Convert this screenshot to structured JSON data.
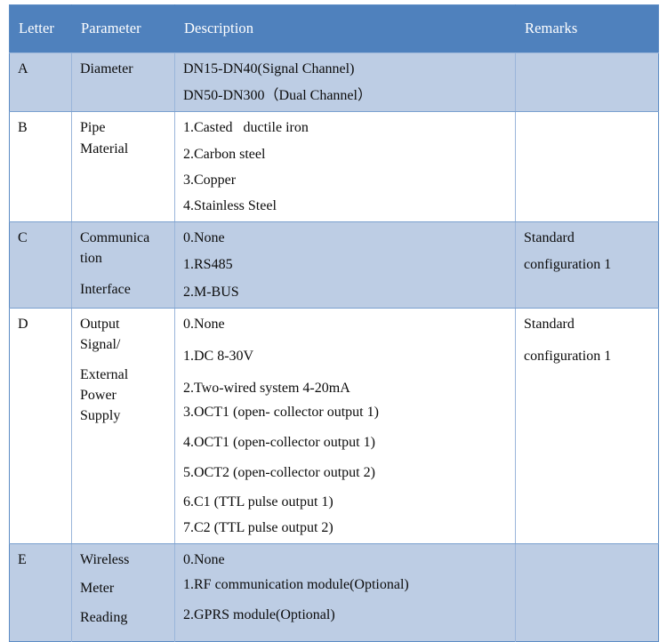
{
  "table": {
    "columns": [
      {
        "key": "letter",
        "label": "Letter"
      },
      {
        "key": "param",
        "label": "Parameter"
      },
      {
        "key": "desc",
        "label": "Description"
      },
      {
        "key": "remarks",
        "label": "Remarks"
      }
    ],
    "header_bg": "#4f81bd",
    "header_text_color": "#ffffff",
    "row_shade_bg": "#bdcde4",
    "row_plain_bg": "#ffffff",
    "border_color": "#9ab5da",
    "rows": [
      {
        "letter": "A",
        "param_lines": [
          "Diameter"
        ],
        "desc_lines": [
          "DN15-DN40(Signal Channel)",
          "DN50-DN300（Dual Channel）"
        ],
        "remarks_lines": [],
        "shaded": true
      },
      {
        "letter": "B",
        "param_lines": [
          "Pipe",
          "Material"
        ],
        "desc_lines": [
          "1.Casted   ductile iron",
          "2.Carbon steel",
          "3.Copper",
          "4.Stainless Steel"
        ],
        "remarks_lines": [],
        "shaded": false
      },
      {
        "letter": "C",
        "param_lines": [
          "Communica",
          "tion",
          "Interface"
        ],
        "desc_lines": [
          "0.None",
          "1.RS485",
          "2.M-BUS"
        ],
        "remarks_lines": [
          "Standard",
          "configuration 1"
        ],
        "shaded": true
      },
      {
        "letter": "D",
        "param_lines": [
          "Output",
          "Signal/",
          "External",
          "Power",
          "Supply"
        ],
        "desc_lines": [
          "0.None",
          "1.DC 8-30V",
          "2.Two-wired system 4-20mA",
          "3.OCT1 (open- collector output 1)",
          "4.OCT1 (open-collector output 1)",
          "5.OCT2 (open-collector output 2)",
          "6.C1 (TTL pulse output 1)",
          "7.C2 (TTL pulse output 2)"
        ],
        "remarks_lines": [
          "Standard",
          "configuration 1"
        ],
        "shaded": false
      },
      {
        "letter": "E",
        "param_lines": [
          "Wireless",
          "Meter",
          "Reading"
        ],
        "desc_lines": [
          "0.None",
          "1.RF communication module(Optional)",
          "2.GPRS module(Optional)"
        ],
        "remarks_lines": [],
        "shaded": true
      }
    ]
  }
}
